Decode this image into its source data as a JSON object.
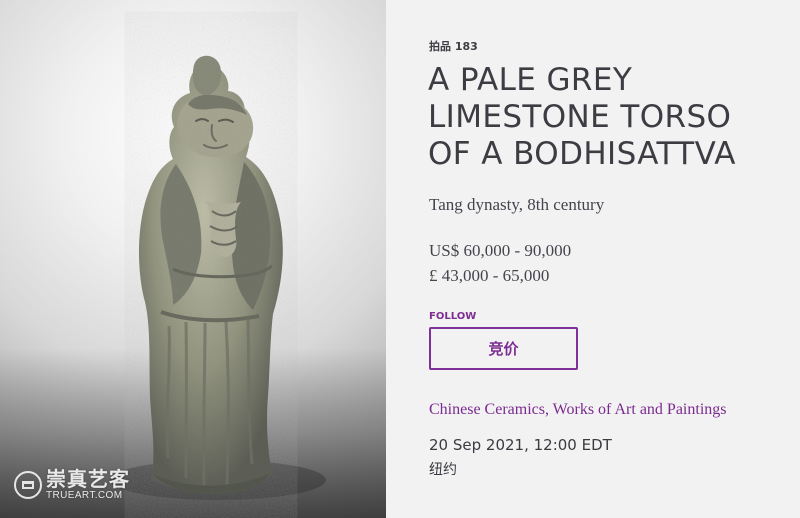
{
  "image": {
    "subject": "limestone-bodhisattva-sculpture"
  },
  "watermark": {
    "cn": "崇真艺客",
    "en": "TRUEART.COM",
    "icon": "trueart-logo-icon"
  },
  "lot": {
    "label": "拍品 183",
    "title": "A PALE GREY LIMESTONE TORSO OF A BODHISATTVA",
    "period": "Tang dynasty, 8th century",
    "estimate_usd": "US$ 60,000 - 90,000",
    "estimate_gbp": "£ 43,000 - 65,000",
    "follow_label": "FOLLOW",
    "bid_label": "竞价",
    "sale_name": "Chinese Ceramics, Works of Art and Paintings",
    "date": "20 Sep 2021, 12:00 EDT",
    "location": "纽约"
  },
  "colors": {
    "background": "#f3f2f3",
    "text": "#3d3c43",
    "accent": "#7d2d92"
  }
}
